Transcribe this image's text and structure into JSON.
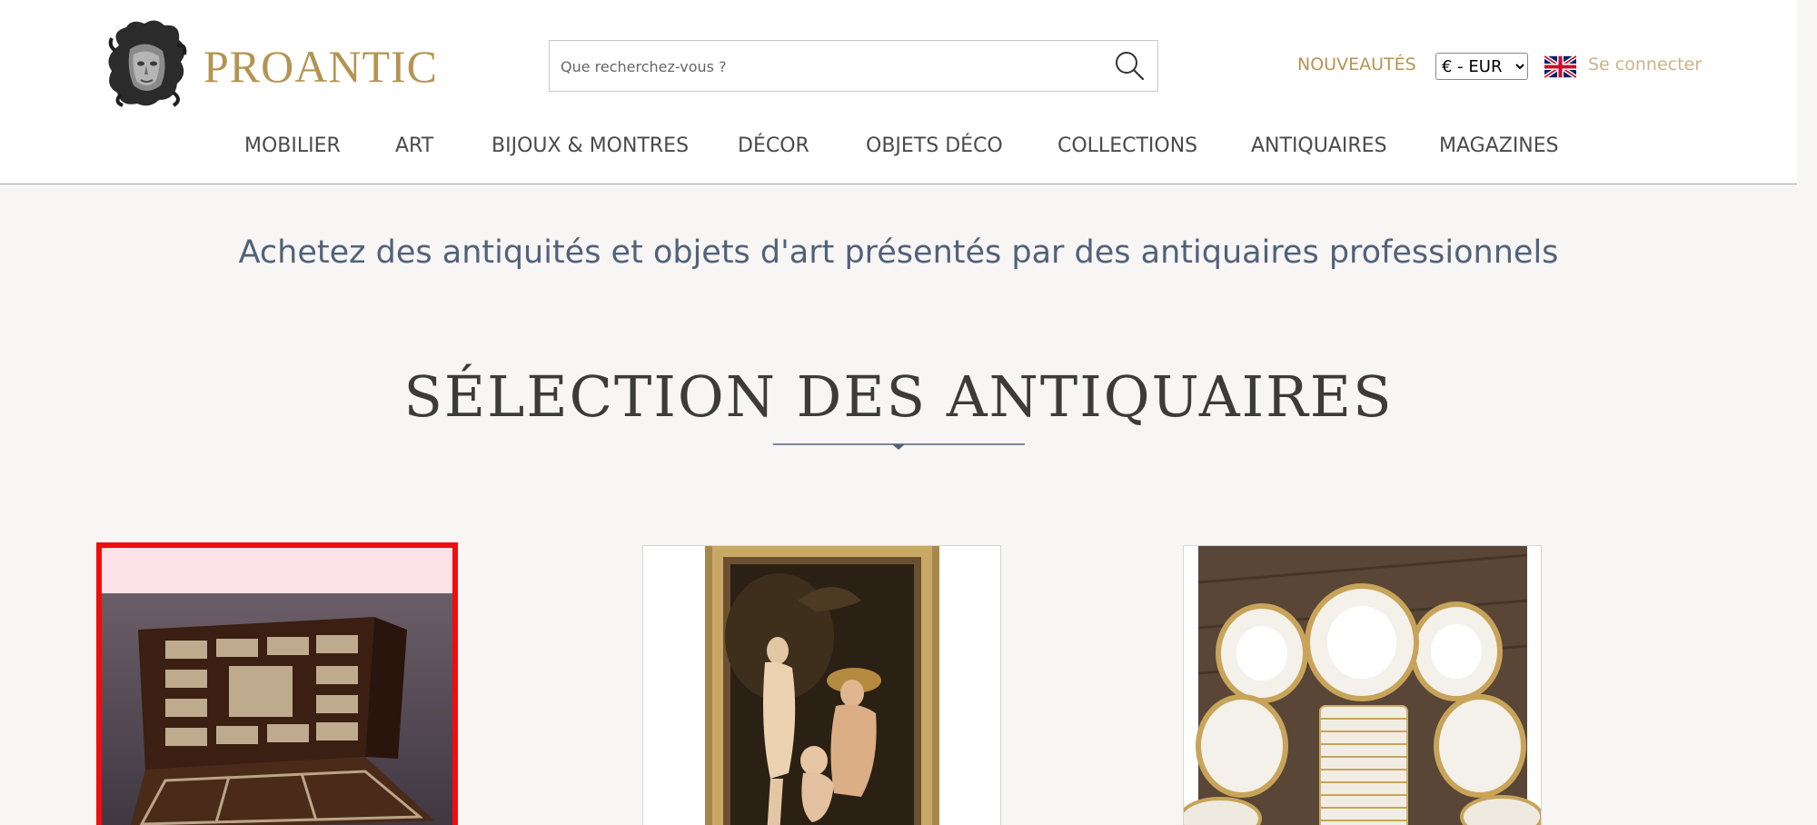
{
  "brand": {
    "name": "PROANTIC",
    "logo_icon": "medusa-head-logo"
  },
  "search": {
    "placeholder": "Que recherchez-vous ?",
    "icon": "search-icon"
  },
  "header": {
    "new_items_label": "NOUVEAUTÉS",
    "currency": {
      "selected": "€ - EUR"
    },
    "language_flag": "uk-flag-icon",
    "login_label": "Se connecter"
  },
  "nav": {
    "items": [
      {
        "label": "MOBILIER"
      },
      {
        "label": "ART"
      },
      {
        "label": "BIJOUX & MONTRES"
      },
      {
        "label": "DÉCOR"
      },
      {
        "label": "OBJETS DÉCO"
      },
      {
        "label": "COLLECTIONS"
      },
      {
        "label": "ANTIQUAIRES"
      },
      {
        "label": "MAGAZINES"
      }
    ]
  },
  "main": {
    "tagline": "Achetez des antiquités et objets d'art présentés par des antiquaires professionnels",
    "section_title": "SÉLECTION DES ANTIQUAIRES"
  },
  "cards": [
    {
      "subject": "antique-cabinet-image"
    },
    {
      "subject": "framed-painting-image"
    },
    {
      "subject": "porcelain-plates-image"
    }
  ],
  "colors": {
    "brand_gold": "#b39451",
    "nav_text": "#4a4a4a",
    "tagline_blue": "#51627a",
    "highlight_red": "#ef0d0d",
    "background": "#f7f6f4"
  }
}
